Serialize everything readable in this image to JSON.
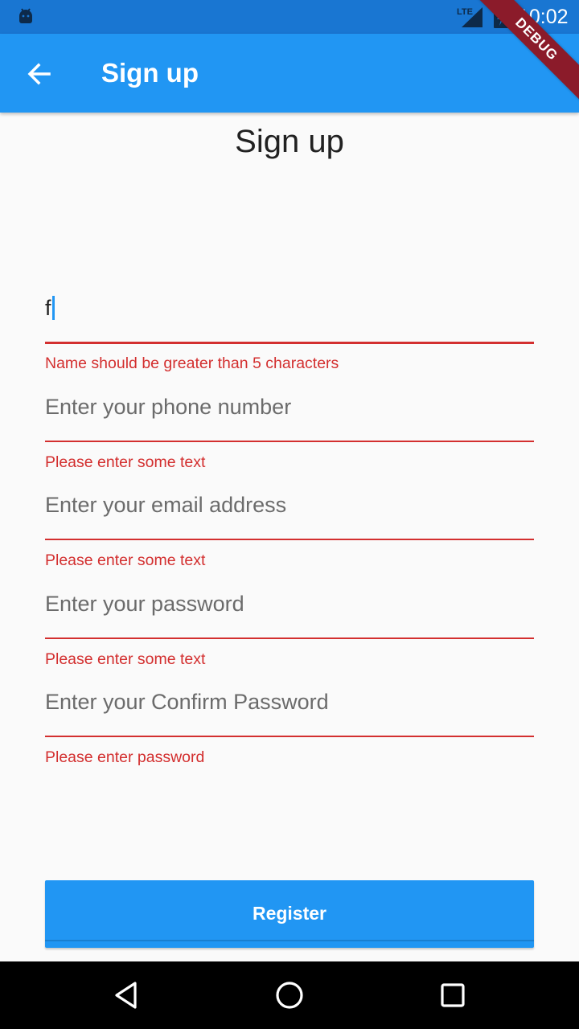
{
  "status_bar": {
    "time": "10:02",
    "network": "LTE",
    "icons": [
      "android-debug-icon",
      "lte-signal-icon",
      "battery-charging-icon"
    ]
  },
  "app_bar": {
    "title": "Sign up",
    "back_icon": "arrow-back-icon"
  },
  "debug_banner": "DEBUG",
  "heading": "Sign up",
  "form": {
    "name": {
      "value": "f",
      "error": "Name should be greater than 5 characters"
    },
    "phone": {
      "placeholder": "Enter your phone number",
      "error": "Please enter some text"
    },
    "email": {
      "placeholder": "Enter your email address",
      "error": "Please enter some text"
    },
    "password": {
      "placeholder": "Enter your password",
      "error": "Please enter some text"
    },
    "confirm_password": {
      "placeholder": "Enter your Confirm Password",
      "error": "Please enter password"
    }
  },
  "register_button": {
    "label": "Register"
  },
  "nav_bar": {
    "icons": [
      "back-triangle-icon",
      "home-circle-icon",
      "recents-square-icon"
    ]
  },
  "colors": {
    "app_bar": "#2196f3",
    "status_bar": "#1976d2",
    "error": "#d32f2f",
    "cursor": "#2196f3",
    "background": "#fafafa"
  }
}
